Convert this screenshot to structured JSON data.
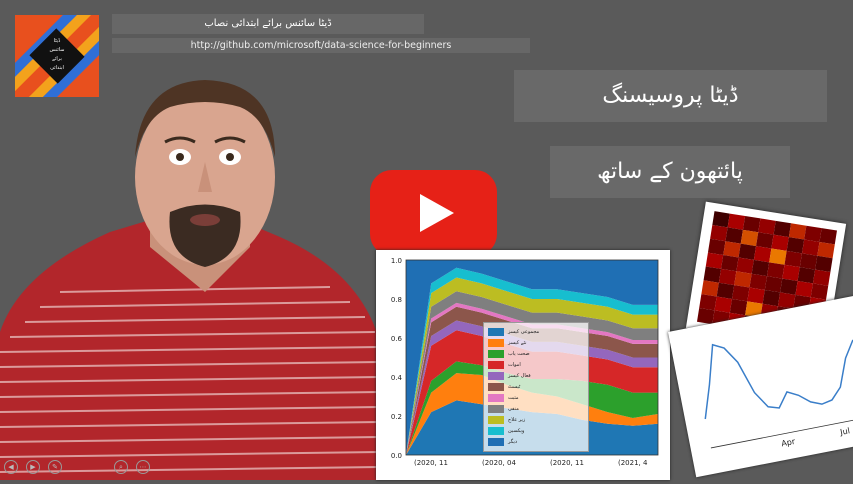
{
  "header": {
    "title": "ڈیٹا سائنس برائے ابتدائی نصاب",
    "url": "http://github.com/microsoft/data-science-for-beginners"
  },
  "logo": {
    "lines": [
      "ڈیٹا",
      "سائنس",
      "برائے",
      "ابتدائی"
    ]
  },
  "callouts": [
    "ڈیٹا پروسیسنگ",
    "پائتھون کے ساتھ"
  ],
  "video": {
    "play_icon": "youtube-play-icon",
    "accent": "#e62117"
  },
  "controls": [
    "◀",
    "▶",
    "✎",
    "⌕",
    "⋯"
  ],
  "chart_data": [
    {
      "type": "area",
      "yticks": [
        "0.0",
        "0.2",
        "0.4",
        "0.6",
        "0.8",
        "1.0"
      ],
      "xticks": [
        "2020, 11",
        "2020, 04",
        "2020, 11",
        "2021, 4"
      ],
      "ylim": [
        0,
        1
      ],
      "legend_position": "center",
      "series": [
        {
          "color": "#1f77b4",
          "values": [
            0.0,
            0.22,
            0.28,
            0.26,
            0.24,
            0.22,
            0.21,
            0.18,
            0.16,
            0.15,
            0.16
          ]
        },
        {
          "color": "#ff7f0e",
          "values": [
            0.0,
            0.1,
            0.14,
            0.15,
            0.12,
            0.1,
            0.09,
            0.08,
            0.06,
            0.04,
            0.05
          ]
        },
        {
          "color": "#2ca02c",
          "values": [
            0.0,
            0.06,
            0.06,
            0.05,
            0.06,
            0.07,
            0.09,
            0.12,
            0.14,
            0.13,
            0.11
          ]
        },
        {
          "color": "#d62728",
          "values": [
            0.0,
            0.18,
            0.16,
            0.15,
            0.15,
            0.14,
            0.14,
            0.13,
            0.13,
            0.13,
            0.13
          ]
        },
        {
          "color": "#9467bd",
          "values": [
            0.0,
            0.05,
            0.05,
            0.05,
            0.05,
            0.05,
            0.05,
            0.05,
            0.05,
            0.05,
            0.05
          ]
        },
        {
          "color": "#8c564b",
          "values": [
            0.0,
            0.07,
            0.07,
            0.07,
            0.07,
            0.07,
            0.07,
            0.07,
            0.07,
            0.07,
            0.07
          ]
        },
        {
          "color": "#e377c2",
          "values": [
            0.0,
            0.02,
            0.02,
            0.02,
            0.02,
            0.02,
            0.02,
            0.02,
            0.02,
            0.02,
            0.02
          ]
        },
        {
          "color": "#7f7f7f",
          "values": [
            0.0,
            0.06,
            0.06,
            0.06,
            0.06,
            0.06,
            0.06,
            0.06,
            0.06,
            0.06,
            0.06
          ]
        },
        {
          "color": "#bcbd22",
          "values": [
            0.0,
            0.07,
            0.07,
            0.07,
            0.07,
            0.07,
            0.07,
            0.07,
            0.07,
            0.07,
            0.07
          ]
        },
        {
          "color": "#17becf",
          "values": [
            0.0,
            0.05,
            0.05,
            0.05,
            0.05,
            0.05,
            0.05,
            0.05,
            0.05,
            0.05,
            0.05
          ]
        },
        {
          "color": "#1f6fb4",
          "values": [
            1.0,
            0.12,
            0.09,
            0.12,
            0.16,
            0.2,
            0.2,
            0.2,
            0.22,
            0.27,
            0.26
          ]
        }
      ],
      "legend": [
        "مجموعی کیسز",
        "نئے کیسز",
        "صحت یاب",
        "اموات",
        "فعال کیسز",
        "ٹیسٹ",
        "مثبت",
        "منفی",
        "زیر علاج",
        "ویکسین",
        "دیگر"
      ]
    },
    {
      "type": "heatmap",
      "rows": 8,
      "cols": 8,
      "values": [
        [
          0.1,
          0.6,
          0.3,
          0.5,
          0.2,
          0.7,
          0.4,
          0.3
        ],
        [
          0.5,
          0.2,
          0.8,
          0.3,
          0.6,
          0.2,
          0.5,
          0.7
        ],
        [
          0.3,
          0.7,
          0.2,
          0.6,
          0.9,
          0.4,
          0.3,
          0.2
        ],
        [
          0.6,
          0.3,
          0.5,
          0.2,
          0.4,
          0.6,
          0.2,
          0.5
        ],
        [
          0.2,
          0.5,
          0.7,
          0.4,
          0.3,
          0.2,
          0.6,
          0.4
        ],
        [
          0.7,
          0.2,
          0.4,
          0.6,
          0.2,
          0.5,
          0.3,
          0.6
        ],
        [
          0.4,
          0.6,
          0.3,
          0.9,
          0.5,
          0.3,
          0.7,
          0.2
        ],
        [
          0.3,
          0.4,
          0.6,
          0.2,
          0.7,
          0.4,
          0.2,
          0.5
        ]
      ]
    },
    {
      "type": "line",
      "xticks": [
        "Apr",
        "Jul"
      ],
      "color": "#3a7ec9",
      "values": [
        0.25,
        0.55,
        0.9,
        0.85,
        0.7,
        0.4,
        0.25,
        0.22,
        0.35,
        0.3,
        0.22,
        0.18,
        0.2,
        0.3,
        0.55,
        0.7
      ]
    }
  ]
}
